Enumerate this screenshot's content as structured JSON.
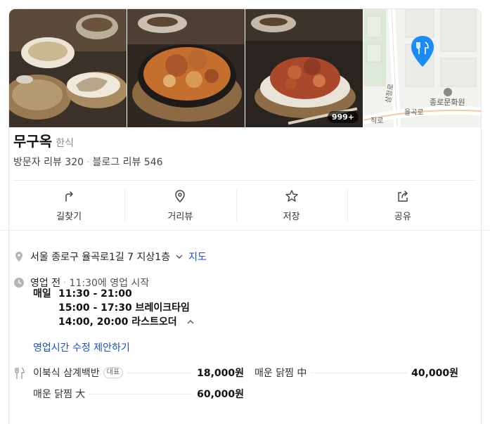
{
  "photos": {
    "count_badge": "999+"
  },
  "map": {
    "road_label_1": "율곡로",
    "road_label_2": "삼청로",
    "road_label_3": "직로",
    "poi_label": "종로문화원"
  },
  "place": {
    "name": "무구옥",
    "category": "한식",
    "visitor_reviews": "방문자 리뷰 320",
    "blog_reviews": "블로그 리뷰 546"
  },
  "actions": [
    {
      "label": "길찾기",
      "icon": "directions-icon"
    },
    {
      "label": "거리뷰",
      "icon": "streetview-icon"
    },
    {
      "label": "저장",
      "icon": "star-icon"
    },
    {
      "label": "공유",
      "icon": "share-icon"
    }
  ],
  "address": {
    "text": "서울 종로구 율곡로1길 7 지상1층",
    "map_link": "지도"
  },
  "status": {
    "state": "영업 전",
    "next": "11:30에 영업 시작"
  },
  "hours": {
    "label": "매일",
    "open": "11:30 - 21:00",
    "break": "15:00 - 17:30 브레이크타임",
    "last_order": "14:00, 20:00 라스트오더"
  },
  "suggest_link": "영업시간 수정 제안하기",
  "menu": [
    {
      "name": "이북식 삼계백반",
      "tag": "대표",
      "price": "18,000원"
    },
    {
      "name": "매운 닭찜 中",
      "price": "40,000원"
    },
    {
      "name": "매운 닭찜 大",
      "price": "60,000원"
    }
  ]
}
